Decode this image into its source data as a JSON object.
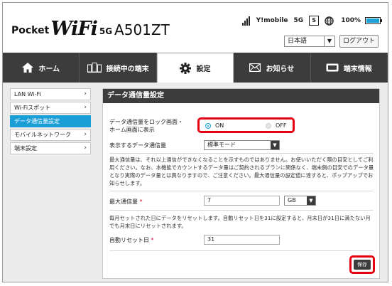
{
  "header": {
    "logo_pocket": "Pocket",
    "logo_wifi": "WiFi",
    "logo_5g": "5G",
    "model": "A501ZT",
    "carrier": "Y!mobile",
    "network": "5G",
    "sim_label": "S",
    "battery": "100%",
    "language": "日本語",
    "logout_label": "ログアウト"
  },
  "nav": {
    "items": [
      {
        "label": "ホーム",
        "icon": "home-icon"
      },
      {
        "label": "接続中の端末",
        "icon": "devices-icon"
      },
      {
        "label": "設定",
        "icon": "gear-icon"
      },
      {
        "label": "お知らせ",
        "icon": "mail-icon"
      },
      {
        "label": "端末情報",
        "icon": "device-info-icon"
      }
    ],
    "active_index": 2
  },
  "sidebar": {
    "items": [
      {
        "label": "LAN Wi-Fi"
      },
      {
        "label": "Wi-Fiスポット"
      },
      {
        "label": "データ通信量設定",
        "active": true
      },
      {
        "label": "モバイルネットワーク"
      },
      {
        "label": "端末設定"
      }
    ]
  },
  "panel": {
    "title": "データ通信量設定",
    "lock_label_line1": "データ通信量をロック画面・",
    "lock_label_line2": "ホーム画面に表示",
    "on_label": "ON",
    "off_label": "OFF",
    "on_selected": true,
    "display_label": "表示するデータ通信量",
    "display_value": "標準モード",
    "notice": "最大通信量は、それ以上通信ができなくなることを示すものではありません。お使いいただく際の目安としてご利用ください。なお、本機能でカウントするデータ量はご契約されるプランに関係なく、端末側の目安でのデータ量となり実際のデータ量とは異なりますので、ご注意ください。最大通信量の設定値に達すると、ポップアップでお知らせします。",
    "max_label": "最大通信量",
    "max_value": "7",
    "max_unit": "GB",
    "reset_notice": "毎月セットされた日にデータをリセットします。自動リセット日を31に設定すると、月末日が31日に満たない月でも月末日にリセットされます。",
    "reset_label": "自動リセット日",
    "reset_value": "31",
    "required_mark": "*",
    "save_label": "保存"
  },
  "colors": {
    "accent": "#1a9ed8",
    "nav_bg": "#3c3c3c",
    "highlight": "#e60012"
  }
}
